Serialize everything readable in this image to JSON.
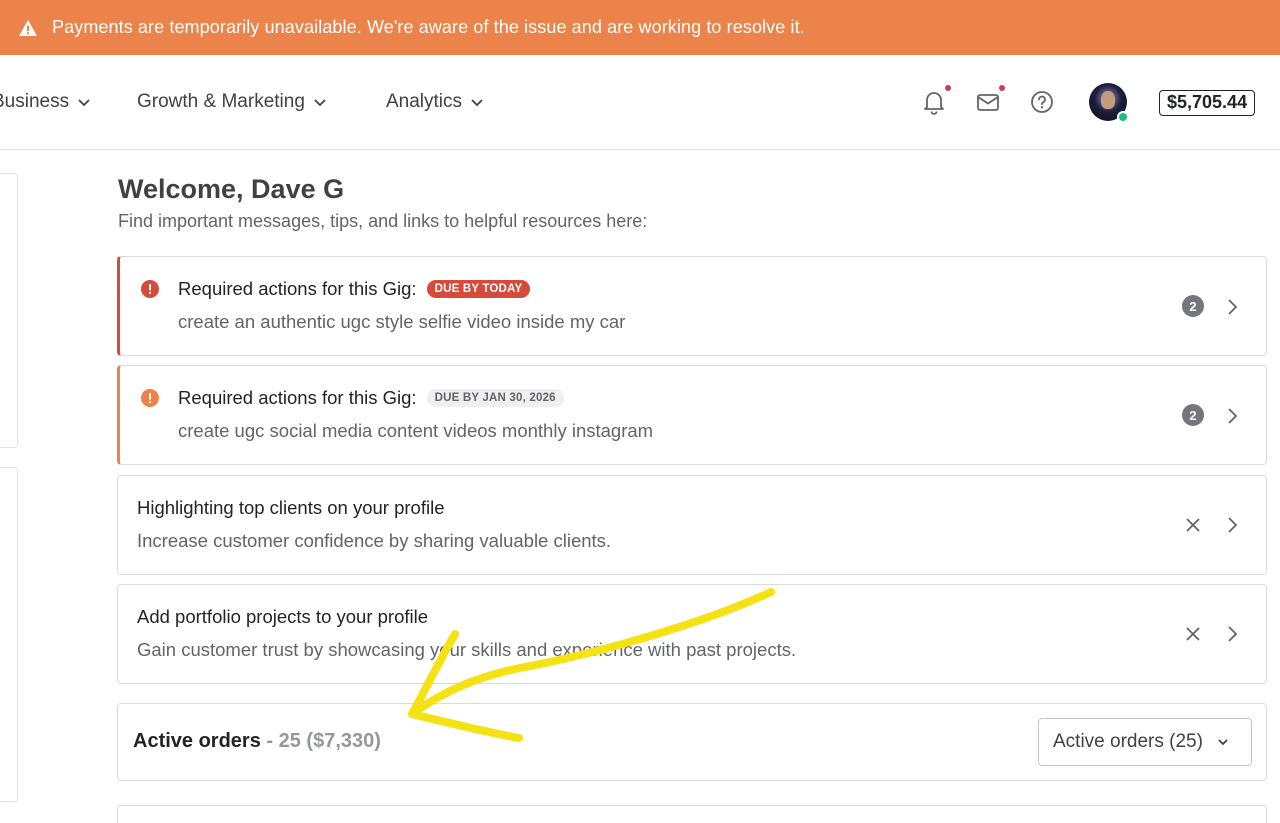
{
  "banner": {
    "text": "Payments are temporarily unavailable. We're aware of the issue and are working to resolve it."
  },
  "nav": {
    "items": [
      {
        "label": "Business"
      },
      {
        "label": "Growth & Marketing"
      },
      {
        "label": "Analytics"
      }
    ],
    "balance": "$5,705.44"
  },
  "welcome": {
    "title": "Welcome, Dave G",
    "subtitle": "Find important messages, tips, and links to helpful resources here:"
  },
  "cards": [
    {
      "title": "Required actions for this Gig:",
      "badge": "DUE BY TODAY",
      "description": "create an authentic ugc style selfie video inside my car",
      "count": "2"
    },
    {
      "title": "Required actions for this Gig:",
      "badge": "DUE BY JAN 30, 2026",
      "description": "create ugc social media content videos monthly instagram",
      "count": "2"
    },
    {
      "title": "Highlighting top clients on your profile",
      "description": "Increase customer confidence by sharing valuable clients."
    },
    {
      "title": "Add portfolio projects to your profile",
      "description": "Gain customer trust by showcasing your skills and experience  with past projects."
    }
  ],
  "orders": {
    "title": "Active orders",
    "meta": " - 25 ($7,330)",
    "select_value": "Active orders (25)"
  },
  "colors": {
    "banner": "#ec834b",
    "alert_red": "#d64a3c",
    "alert_orange": "#ec834b",
    "annotation": "#f5e214"
  }
}
